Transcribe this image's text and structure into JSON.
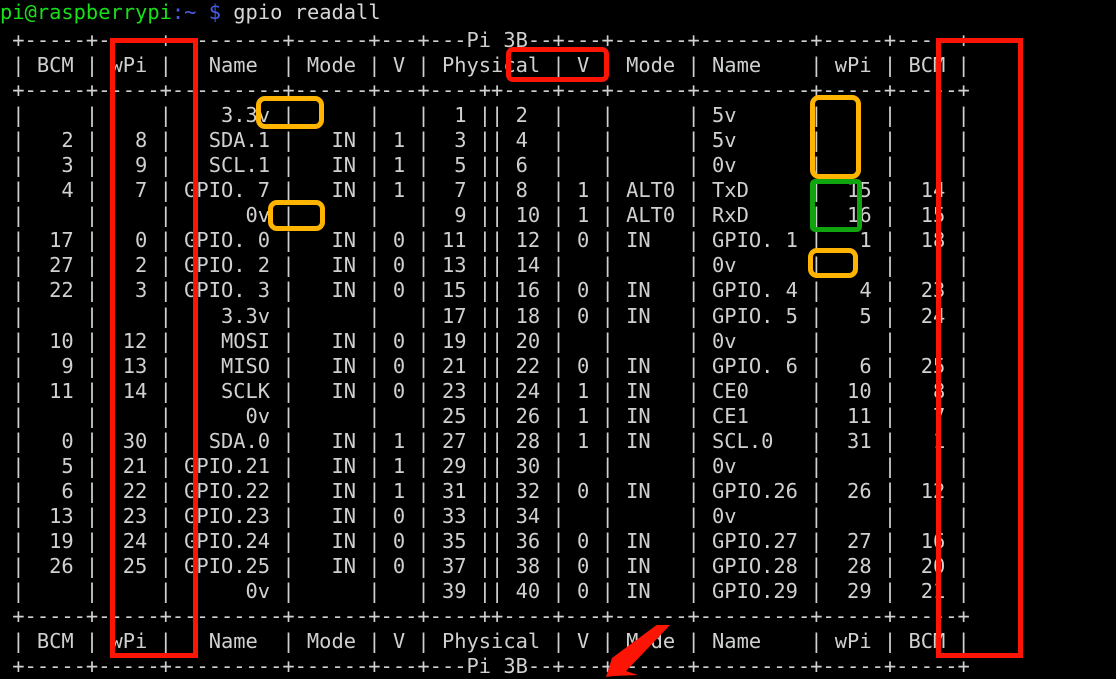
{
  "window": {
    "kind": "terminal",
    "background_color": "#000000",
    "default_text_color": "#cfd0d0"
  },
  "prompt": {
    "user_host": "pi@raspberrypi",
    "user_host_color": "#18e018",
    "path": ":~",
    "path_color": "#4a5ce8",
    "sigil": "$",
    "sigil_color": "#4a5ce8",
    "command": "gpio readall",
    "command_color": "#d6d7d7"
  },
  "table": {
    "title": "Pi 3B",
    "top_border": " +-----+-----+---------+------+---+---Pi 3B--+---+------+---------+-----+-----+",
    "header_row": " | BCM | wPi |   Name  | Mode | V | Physical | V | Mode | Name    | wPi | BCM |",
    "separator": " +-----+-----+---------+------+---+----++----+---+------+---------+-----+-----+",
    "bottom_border": " +-----+-----+---------+------+---+----++----+---+------+---------+-----+-----+",
    "footer_row": " | BCM | wPi |   Name  | Mode | V | Physical | V | Mode | Name    | wPi | BCM |",
    "footer_border": " +-----+-----+---------+------+---+---Pi 3B--+---+------+---------+-----+-----+",
    "columns_left": [
      "BCM",
      "wPi",
      "Name",
      "Mode",
      "V",
      "Physical"
    ],
    "columns_right": [
      "V",
      "Mode",
      "Name",
      "wPi",
      "BCM"
    ],
    "rows": [
      {
        "bcm_l": "",
        "wpi_l": "",
        "name_l": "3.3v",
        "mode_l": "",
        "v_l": "",
        "phys_l": "1",
        "phys_r": "2",
        "v_r": "",
        "mode_r": "",
        "name_r": "5v",
        "wpi_r": "",
        "bcm_r": ""
      },
      {
        "bcm_l": "2",
        "wpi_l": "8",
        "name_l": "SDA.1",
        "mode_l": "IN",
        "v_l": "1",
        "phys_l": "3",
        "phys_r": "4",
        "v_r": "",
        "mode_r": "",
        "name_r": "5v",
        "wpi_r": "",
        "bcm_r": ""
      },
      {
        "bcm_l": "3",
        "wpi_l": "9",
        "name_l": "SCL.1",
        "mode_l": "IN",
        "v_l": "1",
        "phys_l": "5",
        "phys_r": "6",
        "v_r": "",
        "mode_r": "",
        "name_r": "0v",
        "wpi_r": "",
        "bcm_r": ""
      },
      {
        "bcm_l": "4",
        "wpi_l": "7",
        "name_l": "GPIO. 7",
        "mode_l": "IN",
        "v_l": "1",
        "phys_l": "7",
        "phys_r": "8",
        "v_r": "1",
        "mode_r": "ALT0",
        "name_r": "TxD",
        "wpi_r": "15",
        "bcm_r": "14"
      },
      {
        "bcm_l": "",
        "wpi_l": "",
        "name_l": "0v",
        "mode_l": "",
        "v_l": "",
        "phys_l": "9",
        "phys_r": "10",
        "v_r": "1",
        "mode_r": "ALT0",
        "name_r": "RxD",
        "wpi_r": "16",
        "bcm_r": "15"
      },
      {
        "bcm_l": "17",
        "wpi_l": "0",
        "name_l": "GPIO. 0",
        "mode_l": "IN",
        "v_l": "0",
        "phys_l": "11",
        "phys_r": "12",
        "v_r": "0",
        "mode_r": "IN",
        "name_r": "GPIO. 1",
        "wpi_r": "1",
        "bcm_r": "18"
      },
      {
        "bcm_l": "27",
        "wpi_l": "2",
        "name_l": "GPIO. 2",
        "mode_l": "IN",
        "v_l": "0",
        "phys_l": "13",
        "phys_r": "14",
        "v_r": "",
        "mode_r": "",
        "name_r": "0v",
        "wpi_r": "",
        "bcm_r": ""
      },
      {
        "bcm_l": "22",
        "wpi_l": "3",
        "name_l": "GPIO. 3",
        "mode_l": "IN",
        "v_l": "0",
        "phys_l": "15",
        "phys_r": "16",
        "v_r": "0",
        "mode_r": "IN",
        "name_r": "GPIO. 4",
        "wpi_r": "4",
        "bcm_r": "23"
      },
      {
        "bcm_l": "",
        "wpi_l": "",
        "name_l": "3.3v",
        "mode_l": "",
        "v_l": "",
        "phys_l": "17",
        "phys_r": "18",
        "v_r": "0",
        "mode_r": "IN",
        "name_r": "GPIO. 5",
        "wpi_r": "5",
        "bcm_r": "24"
      },
      {
        "bcm_l": "10",
        "wpi_l": "12",
        "name_l": "MOSI",
        "mode_l": "IN",
        "v_l": "0",
        "phys_l": "19",
        "phys_r": "20",
        "v_r": "",
        "mode_r": "",
        "name_r": "0v",
        "wpi_r": "",
        "bcm_r": ""
      },
      {
        "bcm_l": "9",
        "wpi_l": "13",
        "name_l": "MISO",
        "mode_l": "IN",
        "v_l": "0",
        "phys_l": "21",
        "phys_r": "22",
        "v_r": "0",
        "mode_r": "IN",
        "name_r": "GPIO. 6",
        "wpi_r": "6",
        "bcm_r": "25"
      },
      {
        "bcm_l": "11",
        "wpi_l": "14",
        "name_l": "SCLK",
        "mode_l": "IN",
        "v_l": "0",
        "phys_l": "23",
        "phys_r": "24",
        "v_r": "1",
        "mode_r": "IN",
        "name_r": "CE0",
        "wpi_r": "10",
        "bcm_r": "8"
      },
      {
        "bcm_l": "",
        "wpi_l": "",
        "name_l": "0v",
        "mode_l": "",
        "v_l": "",
        "phys_l": "25",
        "phys_r": "26",
        "v_r": "1",
        "mode_r": "IN",
        "name_r": "CE1",
        "wpi_r": "11",
        "bcm_r": "7"
      },
      {
        "bcm_l": "0",
        "wpi_l": "30",
        "name_l": "SDA.0",
        "mode_l": "IN",
        "v_l": "1",
        "phys_l": "27",
        "phys_r": "28",
        "v_r": "1",
        "mode_r": "IN",
        "name_r": "SCL.0",
        "wpi_r": "31",
        "bcm_r": "1"
      },
      {
        "bcm_l": "5",
        "wpi_l": "21",
        "name_l": "GPIO.21",
        "mode_l": "IN",
        "v_l": "1",
        "phys_l": "29",
        "phys_r": "30",
        "v_r": "",
        "mode_r": "",
        "name_r": "0v",
        "wpi_r": "",
        "bcm_r": ""
      },
      {
        "bcm_l": "6",
        "wpi_l": "22",
        "name_l": "GPIO.22",
        "mode_l": "IN",
        "v_l": "1",
        "phys_l": "31",
        "phys_r": "32",
        "v_r": "0",
        "mode_r": "IN",
        "name_r": "GPIO.26",
        "wpi_r": "26",
        "bcm_r": "12"
      },
      {
        "bcm_l": "13",
        "wpi_l": "23",
        "name_l": "GPIO.23",
        "mode_l": "IN",
        "v_l": "0",
        "phys_l": "33",
        "phys_r": "34",
        "v_r": "",
        "mode_r": "",
        "name_r": "0v",
        "wpi_r": "",
        "bcm_r": ""
      },
      {
        "bcm_l": "19",
        "wpi_l": "24",
        "name_l": "GPIO.24",
        "mode_l": "IN",
        "v_l": "0",
        "phys_l": "35",
        "phys_r": "36",
        "v_r": "0",
        "mode_r": "IN",
        "name_r": "GPIO.27",
        "wpi_r": "27",
        "bcm_r": "16"
      },
      {
        "bcm_l": "26",
        "wpi_l": "25",
        "name_l": "GPIO.25",
        "mode_l": "IN",
        "v_l": "0",
        "phys_l": "37",
        "phys_r": "38",
        "v_r": "0",
        "mode_r": "IN",
        "name_r": "GPIO.28",
        "wpi_r": "28",
        "bcm_r": "20"
      },
      {
        "bcm_l": "",
        "wpi_l": "",
        "name_l": "0v",
        "mode_l": "",
        "v_l": "",
        "phys_l": "39",
        "phys_r": "40",
        "v_r": "0",
        "mode_r": "IN",
        "name_r": "GPIO.29",
        "wpi_r": "29",
        "bcm_r": "21"
      }
    ]
  },
  "terminal_lines": [
    " +-----+-----+---------+------+---+---Pi 3B--+---+------+---------+-----+-----+",
    " | BCM | wPi |   Name  | Mode | V | Physical | V | Mode | Name    | wPi | BCM |",
    " +-----+-----+---------+------+---+----++----+---+------+---------+-----+-----+",
    " |     |     |    3.3v |      |   |  1 || 2  |   |      | 5v      |     |     |",
    " |   2 |   8 |   SDA.1 |   IN | 1 |  3 || 4  |   |      | 5v      |     |     |",
    " |   3 |   9 |   SCL.1 |   IN | 1 |  5 || 6  |   |      | 0v      |     |     |",
    " |   4 |   7 | GPIO. 7 |   IN | 1 |  7 || 8  | 1 | ALT0 | TxD     |  15 |  14 |",
    " |     |     |      0v |      |   |  9 || 10 | 1 | ALT0 | RxD     |  16 |  15 |",
    " |  17 |   0 | GPIO. 0 |   IN | 0 | 11 || 12 | 0 | IN   | GPIO. 1 |   1 |  18 |",
    " |  27 |   2 | GPIO. 2 |   IN | 0 | 13 || 14 |   |      | 0v      |     |     |",
    " |  22 |   3 | GPIO. 3 |   IN | 0 | 15 || 16 | 0 | IN   | GPIO. 4 |   4 |  23 |",
    " |     |     |    3.3v |      |   | 17 || 18 | 0 | IN   | GPIO. 5 |   5 |  24 |",
    " |  10 |  12 |    MOSI |   IN | 0 | 19 || 20 |   |      | 0v      |     |     |",
    " |   9 |  13 |    MISO |   IN | 0 | 21 || 22 | 0 | IN   | GPIO. 6 |   6 |  25 |",
    " |  11 |  14 |    SCLK |   IN | 0 | 23 || 24 | 1 | IN   | CE0     |  10 |   8 |",
    " |     |     |      0v |      |   | 25 || 26 | 1 | IN   | CE1     |  11 |   7 |",
    " |   0 |  30 |   SDA.0 |   IN | 1 | 27 || 28 | 1 | IN   | SCL.0   |  31 |   1 |",
    " |   5 |  21 | GPIO.21 |   IN | 1 | 29 || 30 |   |      | 0v      |     |     |",
    " |   6 |  22 | GPIO.22 |   IN | 1 | 31 || 32 | 0 | IN   | GPIO.26 |  26 |  12 |",
    " |  13 |  23 | GPIO.23 |   IN | 0 | 33 || 34 |   |      | 0v      |     |     |",
    " |  19 |  24 | GPIO.24 |   IN | 0 | 35 || 36 | 0 | IN   | GPIO.27 |  27 |  16 |",
    " |  26 |  25 | GPIO.25 |   IN | 0 | 37 || 38 | 0 | IN   | GPIO.28 |  28 |  20 |",
    " |     |     |      0v |      |   | 39 || 40 | 0 | IN   | GPIO.29 |  29 |  21 |",
    " +-----+-----+---------+------+---+----++----+---+------+---------+-----+-----+",
    " | BCM | wPi |   Name  | Mode | V | Physical | V | Mode | Name    | wPi | BCM |",
    " +-----+-----+---------+------+---+---Pi 3B--+---+------+---------+-----+-----+"
  ],
  "annotations": {
    "colors": {
      "red": "#fc1505",
      "yellow": "#ffb400",
      "green": "#0fa50f"
    },
    "highlights": [
      {
        "id": "wpi-left-column",
        "shape": "rect",
        "color": "red",
        "target": "wPi column (left)"
      },
      {
        "id": "wpi-right-column",
        "shape": "rect",
        "color": "red",
        "target": "wPi column (right)"
      },
      {
        "id": "physical-header",
        "shape": "rounded-rect",
        "color": "red",
        "target": "Physical"
      },
      {
        "id": "left-3v3-pin1",
        "shape": "rounded-rect",
        "color": "yellow",
        "target": "3.3v"
      },
      {
        "id": "left-0v-pin9",
        "shape": "rounded-rect",
        "color": "yellow",
        "target": "0v"
      },
      {
        "id": "right-power-pins-2-6",
        "shape": "rounded-rect",
        "color": "yellow",
        "target": "5v / 5v / 0v"
      },
      {
        "id": "right-uart-pins-8-10",
        "shape": "rounded-rect",
        "color": "green",
        "target": "TxD / RxD"
      },
      {
        "id": "right-0v-pin14",
        "shape": "rounded-rect",
        "color": "yellow",
        "target": "0v"
      },
      {
        "id": "pi-3b-arrow",
        "shape": "arrow",
        "color": "red",
        "target": "Pi 3B"
      }
    ]
  }
}
